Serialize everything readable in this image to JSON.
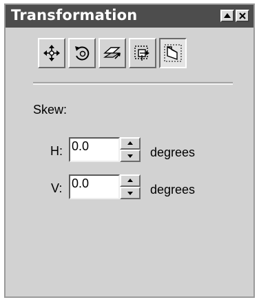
{
  "window": {
    "title": "Transformation",
    "controls": [
      "minimize-icon",
      "close-icon"
    ]
  },
  "toolbar": {
    "tools": [
      {
        "name": "position",
        "icon": "move-arrows-icon"
      },
      {
        "name": "rotate",
        "icon": "rotate-icon"
      },
      {
        "name": "scale",
        "icon": "scale-mirror-icon"
      },
      {
        "name": "size",
        "icon": "size-icon"
      },
      {
        "name": "skew",
        "icon": "skew-icon",
        "active": true
      }
    ]
  },
  "panel": {
    "section_label": "Skew:",
    "h": {
      "label": "H:",
      "value": "0.0",
      "unit": "degrees"
    },
    "v": {
      "label": "V:",
      "value": "0.0",
      "unit": "degrees"
    }
  }
}
